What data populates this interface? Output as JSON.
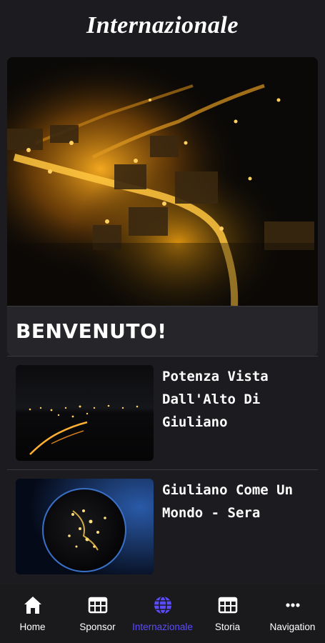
{
  "header": {
    "title": "Internazionale"
  },
  "welcome": {
    "label": "BENVENUTO!"
  },
  "items": [
    {
      "title": "Potenza Vista Dall'Alto Di Giuliano",
      "image": "night-aerial-town-lights"
    },
    {
      "title": "Giuliano Come Un Mondo - Sera",
      "image": "night-globe-town"
    }
  ],
  "tabs": [
    {
      "label": "Home",
      "icon": "home-icon"
    },
    {
      "label": "Sponsor",
      "icon": "table-icon"
    },
    {
      "label": "Internazionale",
      "icon": "globe-icon",
      "active": true
    },
    {
      "label": "Storia",
      "icon": "table-icon"
    },
    {
      "label": "Navigation",
      "icon": "more-icon"
    }
  ],
  "colors": {
    "background": "#1c1c20",
    "accent": "#5b4bff",
    "tabbar": "#1a1a1d"
  }
}
